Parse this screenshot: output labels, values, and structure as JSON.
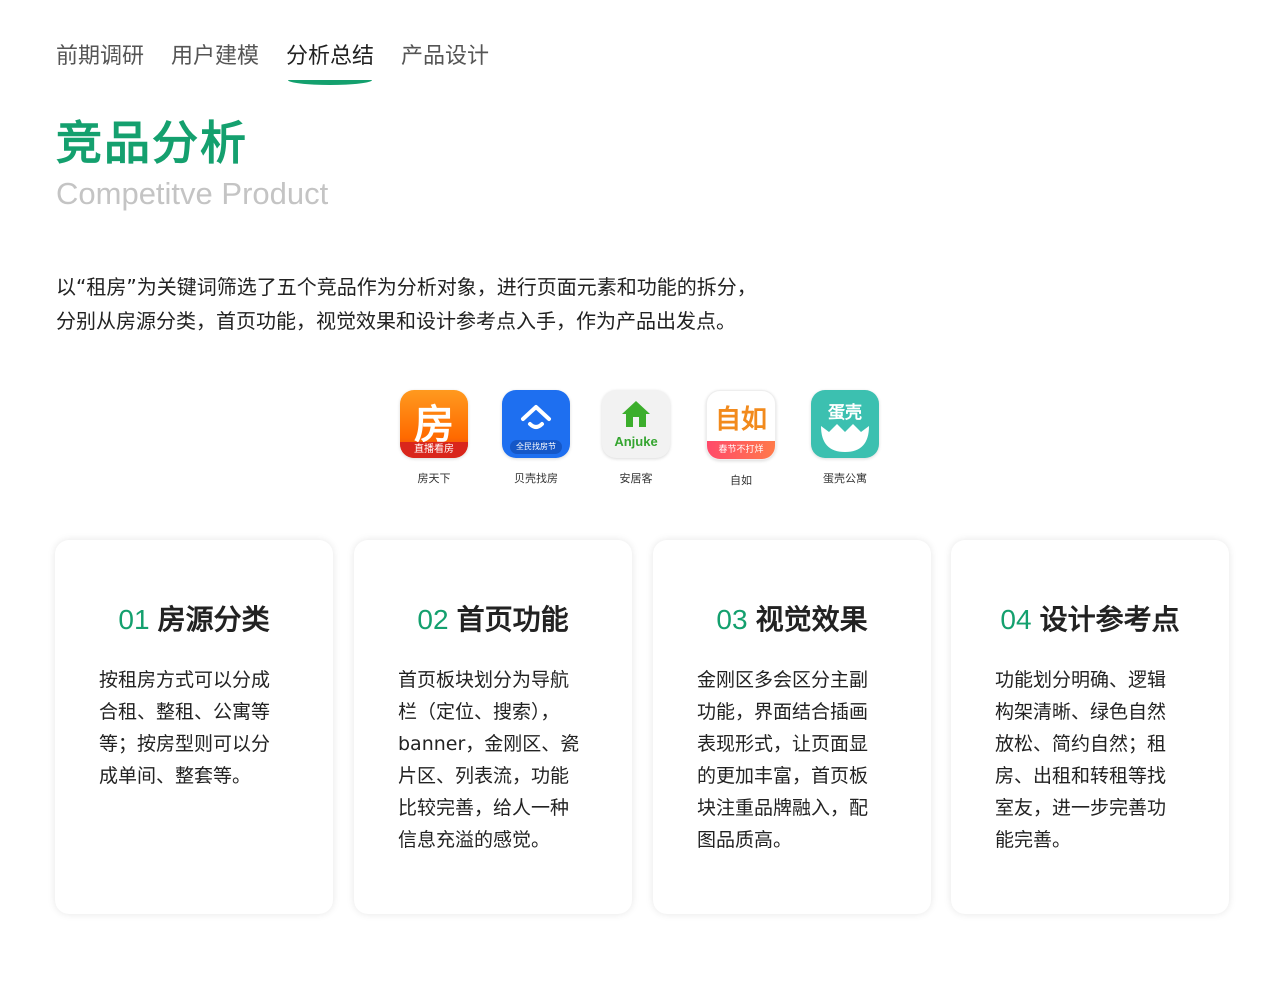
{
  "nav": {
    "tabs": [
      {
        "label": "前期调研"
      },
      {
        "label": "用户建模"
      },
      {
        "label": "分析总结"
      },
      {
        "label": "产品设计"
      }
    ],
    "active_index": 2
  },
  "header": {
    "title": "竞品分析",
    "subtitle": "Competitve Product"
  },
  "intro": {
    "line1": "以“租房”为关键词筛选了五个竞品作为分析对象，进行页面元素和功能的拆分，",
    "line2": "分别从房源分类，首页功能，视觉效果和设计参考点入手，作为产品出发点。"
  },
  "apps": [
    {
      "name": "房天下",
      "icon": "fang-app-icon",
      "icon_text": "房",
      "band_text": "直播看房",
      "color": "#ff7a00"
    },
    {
      "name": "贝壳找房",
      "icon": "beike-app-icon",
      "band_text": "全民找房节",
      "color": "#1e6ff0"
    },
    {
      "name": "安居客",
      "icon": "anjuke-app-icon",
      "icon_text": "Anjuke",
      "color": "#35a530"
    },
    {
      "name": "自如",
      "icon": "ziroom-app-icon",
      "icon_text": "自如",
      "band_text": "春节不打烊",
      "color": "#f28a1c"
    },
    {
      "name": "蛋壳公寓",
      "icon": "danke-app-icon",
      "icon_text": "蛋壳",
      "color": "#3cc0b0"
    }
  ],
  "cards": [
    {
      "num": "01",
      "title": "房源分类",
      "lines": [
        "按租房方式可以分成",
        "合租、整租、公寓等",
        "等；按房型则可以分",
        "成单间、整套等。"
      ]
    },
    {
      "num": "02",
      "title": "首页功能",
      "lines": [
        "首页板块划分为导航",
        "栏（定位、搜索），",
        "banner，金刚区、瓷",
        "片区、列表流，功能",
        "比较完善，给人一种",
        "信息充溢的感觉。"
      ]
    },
    {
      "num": "03",
      "title": "视觉效果",
      "lines": [
        "金刚区多会区分主副",
        "功能，界面结合插画",
        "表现形式，让页面显",
        "的更加丰富，首页板",
        "块注重品牌融入，配",
        "图品质高。"
      ]
    },
    {
      "num": "04",
      "title": "设计参考点",
      "lines": [
        "功能划分明确、逻辑",
        "构架清晰、绿色自然",
        "放松、简约自然；租",
        "房、出租和转租等找",
        "室友，进一步完善功",
        "能完善。"
      ]
    }
  ],
  "colors": {
    "accent": "#14a06e",
    "subtitle": "#c4c4c4"
  }
}
